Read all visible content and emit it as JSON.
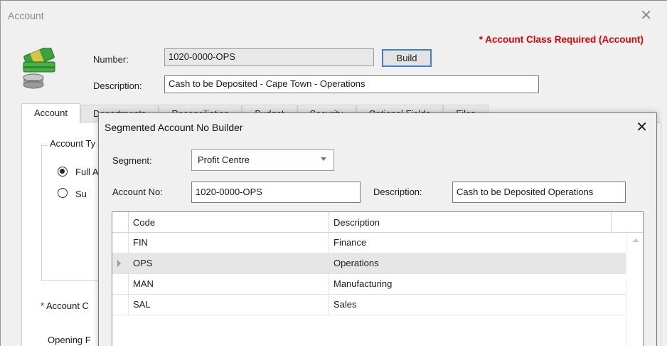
{
  "window": {
    "title": "Account",
    "close_glyph": "✕"
  },
  "required_message": "* Account Class Required (Account)",
  "header": {
    "number_label": "Number:",
    "number_value": "1020-0000-OPS",
    "build_label": "Build",
    "description_label": "Description:",
    "description_value": "Cash to be Deposited - Cape Town - Operations",
    "icon": "money-icon"
  },
  "tabs": [
    {
      "label": "Account",
      "active": true
    },
    {
      "label": "Departments"
    },
    {
      "label": "Reconciliation"
    },
    {
      "label": "Budget"
    },
    {
      "label": "Security"
    },
    {
      "label": "Optional Fields"
    },
    {
      "label": "Files"
    }
  ],
  "account_tab": {
    "group_title": "Account Ty",
    "radio_full": "Full A",
    "radio_sub": "Su",
    "account_class_label": "Account C",
    "account_class_star": "*",
    "opening_label": "Opening F"
  },
  "dialog": {
    "title": "Segmented Account No Builder",
    "close_glyph": "✕",
    "segment_label": "Segment:",
    "segment_value": "Profit Centre",
    "account_no_label": "Account No:",
    "account_no_value": "1020-0000-OPS",
    "description_label": "Description:",
    "description_value": "Cash to be Deposited  Operations",
    "grid": {
      "columns": [
        "Code",
        "Description"
      ],
      "rows": [
        {
          "code": "FIN",
          "description": "Finance"
        },
        {
          "code": "OPS",
          "description": "Operations",
          "selected": true
        },
        {
          "code": "MAN",
          "description": "Manufacturing"
        },
        {
          "code": "SAL",
          "description": "Sales"
        }
      ]
    }
  },
  "colors": {
    "required": "#e00000",
    "focus_border": "#3c7fd4",
    "selected_row": "#e6e6e6"
  }
}
